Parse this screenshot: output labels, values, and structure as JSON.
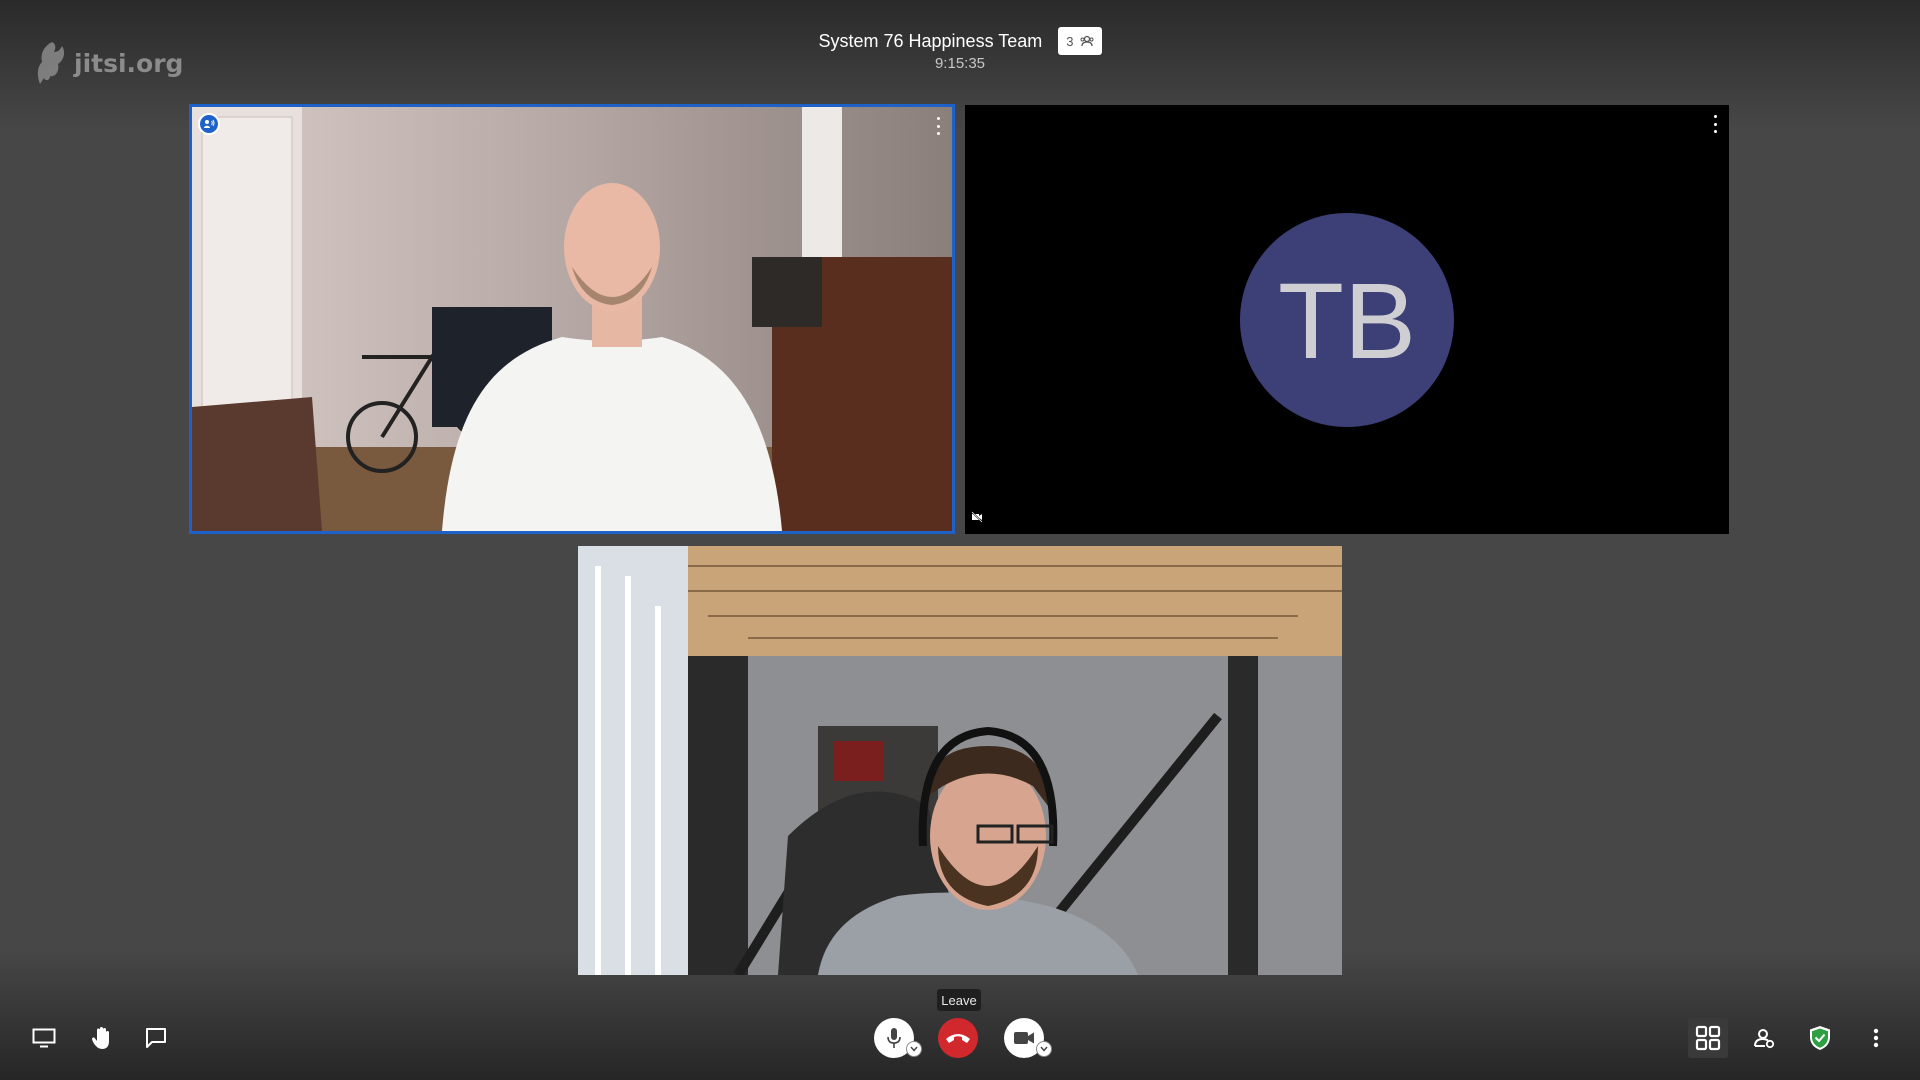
{
  "watermark": {
    "text": "jitsi.org"
  },
  "conference": {
    "subject": "System 76 Happiness Team",
    "participant_count": "3",
    "timer": "9:15:35"
  },
  "tiles": [
    {
      "id": "remote-1",
      "type": "video",
      "dominant_speaker": true,
      "description_icon": "speaker-indicator-icon"
    },
    {
      "id": "remote-2",
      "type": "avatar",
      "initials": "TB",
      "avatar_color": "#3d3f77",
      "camera_off": true
    },
    {
      "id": "local",
      "type": "video"
    }
  ],
  "toolbar": {
    "hangup_tooltip": "Leave",
    "left": [
      "screen-share-icon",
      "raise-hand-icon",
      "chat-icon"
    ],
    "center": [
      "microphone-icon",
      "hangup-icon",
      "camera-icon"
    ],
    "right": [
      "tile-view-icon",
      "invite-icon",
      "security-icon",
      "more-icon"
    ]
  },
  "colors": {
    "background": "#474747",
    "dominant_border": "#1e62c9",
    "hangup": "#d0282d",
    "security_shield": "#2ea043"
  }
}
